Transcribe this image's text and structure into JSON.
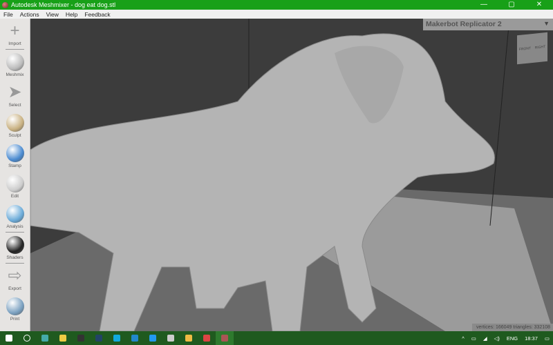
{
  "window": {
    "title": "Autodesk Meshmixer - dog eat dog.stl",
    "minimize": "—",
    "maximize": "▢",
    "close": "✕"
  },
  "menu": [
    "File",
    "Actions",
    "View",
    "Help",
    "Feedback"
  ],
  "tools": [
    {
      "label": "Import",
      "icon": "plus-icon"
    },
    {
      "label": "Meshmix",
      "icon": "meshmix-icon"
    },
    {
      "label": "Select",
      "icon": "select-arrow-icon"
    },
    {
      "label": "Sculpt",
      "icon": "sculpt-brush-icon"
    },
    {
      "label": "Stamp",
      "icon": "stamp-icon"
    },
    {
      "label": "Edit",
      "icon": "edit-icon"
    },
    {
      "label": "Analysis",
      "icon": "analysis-icon"
    },
    {
      "label": "Shaders",
      "icon": "shaders-icon"
    },
    {
      "label": "Export",
      "icon": "export-icon"
    },
    {
      "label": "Print",
      "icon": "print-icon"
    }
  ],
  "viewport": {
    "printer": "Makerbot Replicator 2",
    "cube_front": "FRONT",
    "cube_right": "RIGHT",
    "stats": "vertices: 166049 triangles: 332108"
  },
  "taskbar": {
    "lang": "ENG",
    "time": "18:37",
    "apps": [
      "start-icon",
      "search-icon",
      "app-icon",
      "store-icon",
      "epic-icon",
      "steam-icon",
      "c-app-icon",
      "mail-icon",
      "phone-icon",
      "game-icon",
      "explorer-icon",
      "chrome-icon",
      "meshmixer-icon"
    ]
  },
  "colors": {
    "titlebar": "#18a018",
    "taskbar": "#1f5a1f"
  }
}
